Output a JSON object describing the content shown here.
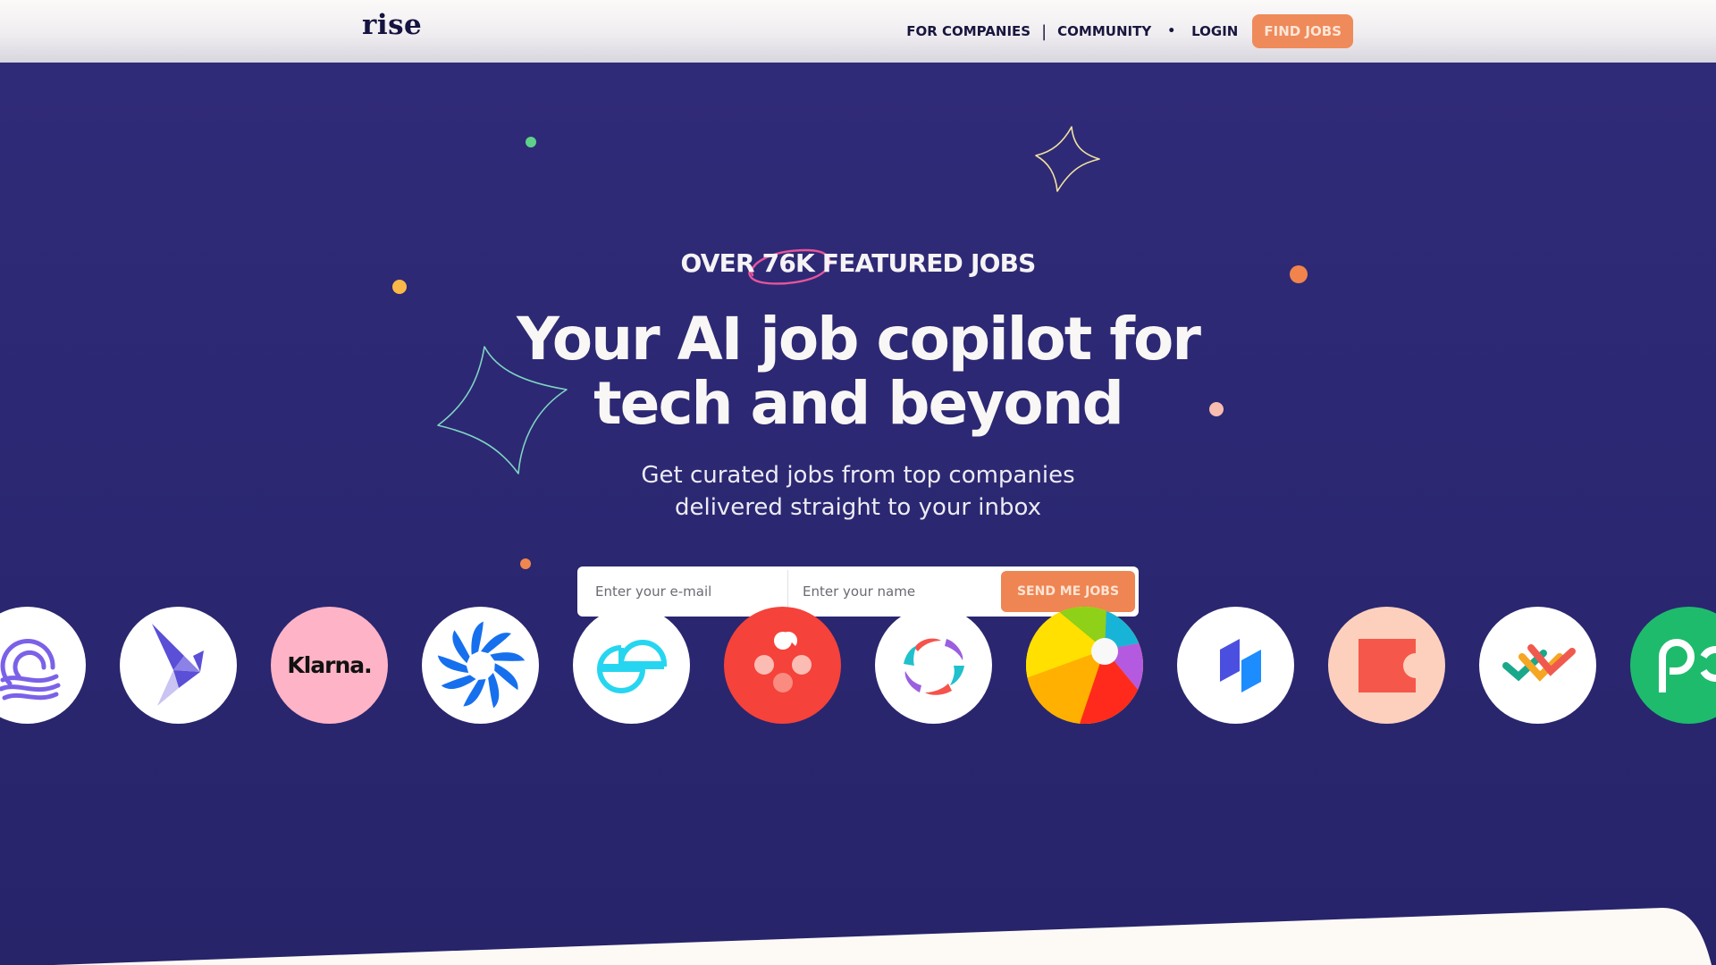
{
  "header": {
    "logo": "rise",
    "nav": {
      "for_companies": "FOR COMPANIES",
      "separator": "|",
      "community": "COMMUNITY",
      "dot": "•",
      "login": "LOGIN",
      "find_jobs": "FIND JOBS"
    }
  },
  "hero": {
    "kicker": "OVER 76K FEATURED JOBS",
    "headline_line1": "Your AI job copilot for",
    "headline_line2": "tech and beyond",
    "subtitle_line1": "Get curated jobs from top companies",
    "subtitle_line2": "delivered straight to your inbox",
    "form": {
      "email_placeholder": "Enter your e-mail",
      "name_placeholder": "Enter your name",
      "submit_label": "SEND ME JOBS"
    }
  },
  "company_logos": [
    {
      "name": "wave-rings-logo",
      "bg": "#ffffff"
    },
    {
      "name": "origami-bird-logo",
      "bg": "#ffffff"
    },
    {
      "name": "klarna-logo",
      "bg": "#ffb3c7",
      "text": "Klarna."
    },
    {
      "name": "blue-swirl-logo",
      "bg": "#ffffff"
    },
    {
      "name": "gemini-logo",
      "bg": "#ffffff"
    },
    {
      "name": "red-petals-logo",
      "bg": "#f5423a"
    },
    {
      "name": "multicolor-ring-logo",
      "bg": "#ffffff"
    },
    {
      "name": "beach-ball-logo",
      "bg": "#ffcc00"
    },
    {
      "name": "blue-blocks-logo",
      "bg": "#ffffff"
    },
    {
      "name": "coda-logo",
      "bg": "#fdd0bd"
    },
    {
      "name": "woven-chevrons-logo",
      "bg": "#ffffff"
    },
    {
      "name": "green-pc-logo",
      "bg": "#1ebb6d"
    }
  ],
  "colors": {
    "hero_bg": "#2c2873",
    "accent_orange": "#ee8553",
    "header_text": "#18163e"
  }
}
